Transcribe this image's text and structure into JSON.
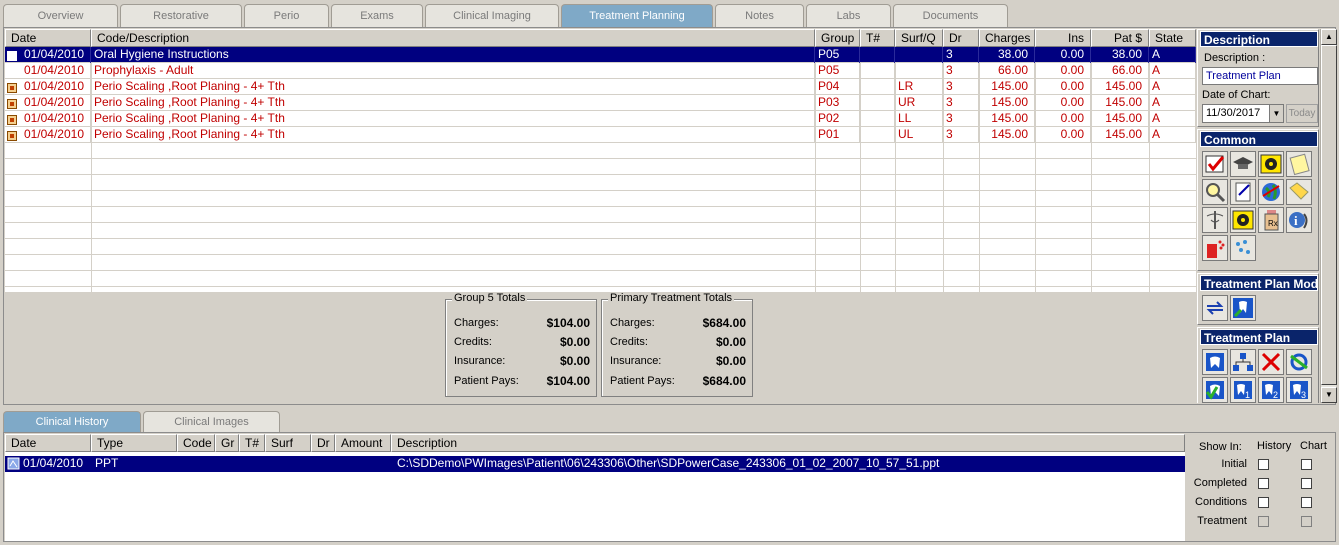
{
  "top_tabs": [
    "Overview",
    "Restorative",
    "Perio",
    "Exams",
    "Clinical Imaging",
    "Treatment Planning",
    "Notes",
    "Labs",
    "Documents"
  ],
  "active_top_tab": "Treatment Planning",
  "grid": {
    "headers": [
      "Date",
      "Code/Description",
      "Group",
      "T#",
      "Surf/Q",
      "Dr",
      "Charges",
      "Ins",
      "Pat $",
      "State"
    ],
    "rows": [
      {
        "date": "01/04/2010",
        "desc": "Oral Hygiene Instructions",
        "group": "P05",
        "tooth": "",
        "surf": "",
        "dr": "3",
        "charges": "38.00",
        "ins": "0.00",
        "pat": "38.00",
        "state": "A",
        "selected": true,
        "icon": "checkbox"
      },
      {
        "date": "01/04/2010",
        "desc": "Prophylaxis - Adult",
        "group": "P05",
        "tooth": "",
        "surf": "",
        "dr": "3",
        "charges": "66.00",
        "ins": "0.00",
        "pat": "66.00",
        "state": "A",
        "selected": false,
        "icon": ""
      },
      {
        "date": "01/04/2010",
        "desc": "Perio Scaling ,Root Planing - 4+ Tth",
        "group": "P04",
        "tooth": "",
        "surf": "LR",
        "dr": "3",
        "charges": "145.00",
        "ins": "0.00",
        "pat": "145.00",
        "state": "A",
        "selected": false,
        "icon": "flag"
      },
      {
        "date": "01/04/2010",
        "desc": "Perio Scaling ,Root Planing - 4+ Tth",
        "group": "P03",
        "tooth": "",
        "surf": "UR",
        "dr": "3",
        "charges": "145.00",
        "ins": "0.00",
        "pat": "145.00",
        "state": "A",
        "selected": false,
        "icon": "flag"
      },
      {
        "date": "01/04/2010",
        "desc": "Perio Scaling ,Root Planing - 4+ Tth",
        "group": "P02",
        "tooth": "",
        "surf": "LL",
        "dr": "3",
        "charges": "145.00",
        "ins": "0.00",
        "pat": "145.00",
        "state": "A",
        "selected": false,
        "icon": "flag"
      },
      {
        "date": "01/04/2010",
        "desc": "Perio Scaling ,Root Planing - 4+ Tth",
        "group": "P01",
        "tooth": "",
        "surf": "UL",
        "dr": "3",
        "charges": "145.00",
        "ins": "0.00",
        "pat": "145.00",
        "state": "A",
        "selected": false,
        "icon": "flag"
      }
    ]
  },
  "group_totals": {
    "title": "Group 5 Totals",
    "charges_label": "Charges:",
    "charges": "$104.00",
    "credits_label": "Credits:",
    "credits": "$0.00",
    "insurance_label": "Insurance:",
    "insurance": "$0.00",
    "patient_label": "Patient Pays:",
    "patient": "$104.00"
  },
  "primary_totals": {
    "title": "Primary Treatment Totals",
    "charges_label": "Charges:",
    "charges": "$684.00",
    "credits_label": "Credits:",
    "credits": "$0.00",
    "insurance_label": "Insurance:",
    "insurance": "$0.00",
    "patient_label": "Patient Pays:",
    "patient": "$684.00"
  },
  "right_panel": {
    "description_header": "Description",
    "description_label": "Description :",
    "description_value": "Treatment Plan",
    "date_label": "Date of Chart:",
    "date_value": "11/30/2017",
    "today_button": "Today",
    "common_header": "Common",
    "tp_mod_header": "Treatment Plan Mod",
    "tp_header": "Treatment Plan",
    "tp_icon_numbers": [
      "1",
      "2",
      "3"
    ]
  },
  "bottom_tabs": [
    "Clinical History",
    "Clinical Images"
  ],
  "active_bottom_tab": "Clinical History",
  "history_grid": {
    "headers": [
      "Date",
      "Type",
      "Code",
      "Gr",
      "T#",
      "Surf",
      "Dr",
      "Amount",
      "Description"
    ],
    "row": {
      "date": "01/04/2010",
      "type": "PPT",
      "description": "C:\\SDDemo\\PWImages\\Patient\\06\\243306\\Other\\SDPowerCase_243306_01_02_2007_10_57_51.ppt"
    }
  },
  "show_in": {
    "label": "Show In:",
    "col_history": "History",
    "col_chart": "Chart",
    "rows": [
      "Initial",
      "Completed",
      "Conditions",
      "Treatment"
    ]
  },
  "colors": {
    "selected_row": "#000080",
    "tp_text": "#c00000",
    "active_tab": "#7fa9c7",
    "panel_header": "#0a246a"
  }
}
